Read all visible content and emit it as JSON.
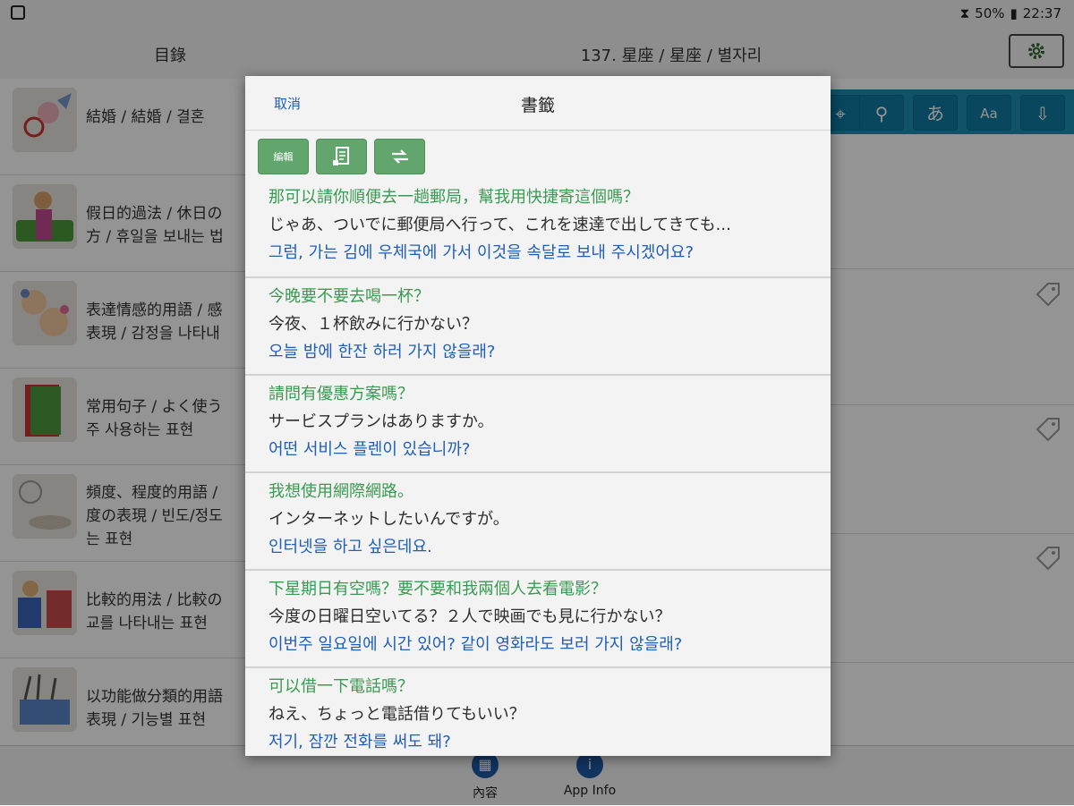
{
  "status": {
    "battery": "50%",
    "time": "22:37"
  },
  "topbar": {
    "toc_title": "目錄",
    "lesson_title": "137. 星座 / 星座 / 별자리"
  },
  "list": {
    "items": [
      {
        "line1": "結婚 / 結婚 / 결혼",
        "line2": ""
      },
      {
        "line1": "假日的過法 / 休日の",
        "line2": "方 / 휴일을 보내는 법"
      },
      {
        "line1": "表達情感的用語 / 感",
        "line2": "表現 / 감정을 나타내"
      },
      {
        "line1": "常用句子 / よく使う",
        "line2": "주 사용하는 표현"
      },
      {
        "line1": "頻度、程度的用語 /",
        "line2": "度の表現 / 빈도/정도",
        "line3": "는 표현"
      },
      {
        "line1": "比較的用法 / 比較の",
        "line2": "교를 나타내는 표현"
      },
      {
        "line1": "以功能做分類的用語",
        "line2": "表現 / 기능별 표현"
      }
    ]
  },
  "toolbar": {
    "kana_label": "あ",
    "font_label": "Aa"
  },
  "bottom_nav": {
    "content_label": "內容",
    "app_info_label": "App Info"
  },
  "dialog": {
    "cancel_label": "取消",
    "title": "書籤",
    "edit_label": "編輯",
    "entries": [
      {
        "zh": "那可以請你順便去一趟郵局，幫我用快捷寄這個嗎？",
        "ja": "じゃあ、ついでに郵便局へ行って、これを速達で出してきても...",
        "ko": "그럼, 가는 김에 우체국에 가서 이것을 속달로 보내 주시겠어요?"
      },
      {
        "zh": "今晚要不要去喝一杯？",
        "ja": "今夜、１杯飲みに行かない？",
        "ko": "오늘 밤에 한잔 하러 가지 않을래?"
      },
      {
        "zh": "請問有優惠方案嗎？",
        "ja": "サービスプランはありますか。",
        "ko": "어떤 서비스 플렌이 있습니까?"
      },
      {
        "zh": "我想使用網際網路。",
        "ja": "インターネットしたいんですが。",
        "ko": "인터넷을 하고 싶은데요."
      },
      {
        "zh": "下星期日有空嗎？要不要和我兩個人去看電影？",
        "ja": "今度の日曜日空いてる？２人で映画でも見に行かない？",
        "ko": "이번주 일요일에 시간 있어? 같이 영화라도 보러 가지 않을래?"
      },
      {
        "zh": "可以借一下電話嗎？",
        "ja": "ねえ、ちょっと電話借りてもいい？",
        "ko": "저기, 잠깐 전화를 써도 돼?"
      }
    ]
  },
  "colors": {
    "accent_green": "#62a66d",
    "text_green": "#3a9a52",
    "text_blue": "#1f5fb8",
    "toolbar_blue": "#1e8db4"
  }
}
